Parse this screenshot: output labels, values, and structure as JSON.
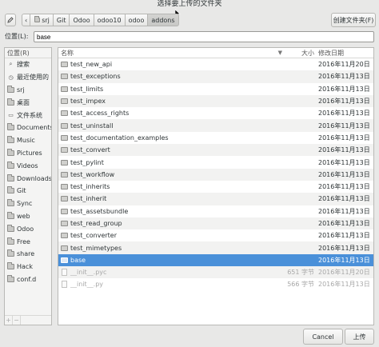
{
  "window": {
    "title": "选择要上传的文件夹"
  },
  "toolbar": {
    "crumbs": [
      "srj",
      "Git",
      "Odoo",
      "odoo10",
      "odoo",
      "addons"
    ],
    "create_folder_label": "创建文件夹(F)"
  },
  "location": {
    "label": "位置(L):",
    "value": "base"
  },
  "sidebar": {
    "header": "位置(R)",
    "items": [
      {
        "label": "搜索",
        "icon": "search-icon"
      },
      {
        "label": "最近使用的",
        "icon": "recent-icon"
      },
      {
        "label": "srj",
        "icon": "home-folder-icon"
      },
      {
        "label": "桌面",
        "icon": "desktop-folder-icon"
      },
      {
        "label": "文件系统",
        "icon": "filesystem-icon"
      },
      {
        "label": "Documents",
        "icon": "folder-icon"
      },
      {
        "label": "Music",
        "icon": "folder-icon"
      },
      {
        "label": "Pictures",
        "icon": "folder-icon"
      },
      {
        "label": "Videos",
        "icon": "folder-icon"
      },
      {
        "label": "Downloads",
        "icon": "folder-icon"
      },
      {
        "label": "Git",
        "icon": "folder-icon"
      },
      {
        "label": "Sync",
        "icon": "folder-icon"
      },
      {
        "label": "web",
        "icon": "folder-icon"
      },
      {
        "label": "Odoo",
        "icon": "folder-icon"
      },
      {
        "label": "Free",
        "icon": "folder-icon"
      },
      {
        "label": "share",
        "icon": "folder-icon"
      },
      {
        "label": "Hack",
        "icon": "folder-icon"
      },
      {
        "label": "conf.d",
        "icon": "folder-icon"
      }
    ],
    "add_label": "+",
    "remove_label": "−"
  },
  "files": {
    "columns": {
      "name": "名称",
      "size": "大小",
      "modified": "修改日期"
    },
    "rows": [
      {
        "name": "test_new_api",
        "size": "",
        "date": "2016年11月20日",
        "type": "folder"
      },
      {
        "name": "test_exceptions",
        "size": "",
        "date": "2016年11月13日",
        "type": "folder"
      },
      {
        "name": "test_limits",
        "size": "",
        "date": "2016年11月13日",
        "type": "folder"
      },
      {
        "name": "test_impex",
        "size": "",
        "date": "2016年11月13日",
        "type": "folder"
      },
      {
        "name": "test_access_rights",
        "size": "",
        "date": "2016年11月13日",
        "type": "folder"
      },
      {
        "name": "test_uninstall",
        "size": "",
        "date": "2016年11月13日",
        "type": "folder"
      },
      {
        "name": "test_documentation_examples",
        "size": "",
        "date": "2016年11月13日",
        "type": "folder"
      },
      {
        "name": "test_convert",
        "size": "",
        "date": "2016年11月13日",
        "type": "folder"
      },
      {
        "name": "test_pylint",
        "size": "",
        "date": "2016年11月13日",
        "type": "folder"
      },
      {
        "name": "test_workflow",
        "size": "",
        "date": "2016年11月13日",
        "type": "folder"
      },
      {
        "name": "test_inherits",
        "size": "",
        "date": "2016年11月13日",
        "type": "folder"
      },
      {
        "name": "test_inherit",
        "size": "",
        "date": "2016年11月13日",
        "type": "folder"
      },
      {
        "name": "test_assetsbundle",
        "size": "",
        "date": "2016年11月13日",
        "type": "folder"
      },
      {
        "name": "test_read_group",
        "size": "",
        "date": "2016年11月13日",
        "type": "folder"
      },
      {
        "name": "test_converter",
        "size": "",
        "date": "2016年11月13日",
        "type": "folder"
      },
      {
        "name": "test_mimetypes",
        "size": "",
        "date": "2016年11月13日",
        "type": "folder"
      },
      {
        "name": "base",
        "size": "",
        "date": "2016年11月13日",
        "type": "folder",
        "selected": true
      },
      {
        "name": "__init__.pyc",
        "size": "651 字节",
        "date": "2016年11月20日",
        "type": "file"
      },
      {
        "name": "__init__.py",
        "size": "566 字节",
        "date": "2016年11月13日",
        "type": "file"
      }
    ]
  },
  "footer": {
    "cancel_label": "Cancel",
    "upload_label": "上传"
  },
  "colors": {
    "selection": "#4a90d9",
    "window_bg": "#e8e8e7"
  }
}
